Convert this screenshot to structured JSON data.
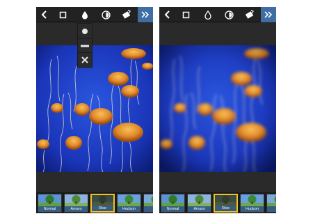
{
  "screens": [
    {
      "id": "left",
      "tilt_shift_menu_open": true,
      "tilt_shift_options": [
        "circle-icon",
        "bar-icon",
        "close-icon"
      ],
      "photo_blur": "none",
      "filters": [
        {
          "label": "Normal",
          "selected": false
        },
        {
          "label": "Amaro",
          "selected": false
        },
        {
          "label": "Rise",
          "selected": true
        },
        {
          "label": "Hudson",
          "selected": false
        },
        {
          "label": "Sie",
          "selected": false
        }
      ]
    },
    {
      "id": "right",
      "tilt_shift_menu_open": false,
      "photo_blur": "radial",
      "filters": [
        {
          "label": "Normal",
          "selected": false
        },
        {
          "label": "Amaro",
          "selected": false
        },
        {
          "label": "Rise",
          "selected": true
        },
        {
          "label": "Hudson",
          "selected": false
        },
        {
          "label": "Sie",
          "selected": false
        }
      ]
    }
  ],
  "toolbar_icons": [
    "back-icon",
    "crop-icon",
    "tilt-shift-icon",
    "lux-icon",
    "rotate-icon",
    "next-icon"
  ],
  "colors": {
    "toolbar_bg": "#222222",
    "next_button": "#3f6ea5",
    "selected_filter_border": "#f2c21b",
    "water": "#1d3fc4",
    "jellyfish": "#e08a2a"
  }
}
